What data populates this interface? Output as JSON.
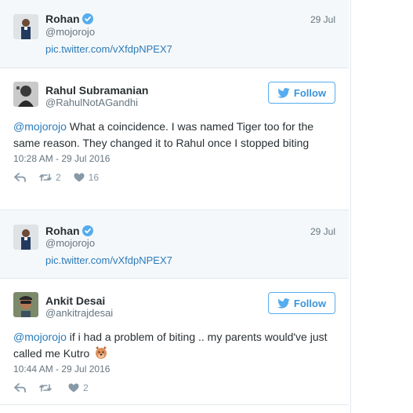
{
  "colors": {
    "accent": "#55acee",
    "link": "#2b7bb9",
    "muted": "#66757f",
    "quoted_bg": "#f5f8fa"
  },
  "thread": [
    {
      "quoted": {
        "name": "Rohan",
        "verified": true,
        "handle": "@mojorojo",
        "date": "29 Jul",
        "link": "pic.twitter.com/vXfdpNPEX7"
      }
    },
    {
      "reply": {
        "name": "Rahul Subramanian",
        "handle": "@RahulNotAGandhi",
        "follow_label": "Follow",
        "mention": "@mojorojo",
        "text": " What a coincidence. I was named Tiger too for the same reason. They changed it to Rahul once I stopped biting",
        "time": "10:28 AM - 29 Jul 2016",
        "retweets": "2",
        "likes": "16",
        "icons": [
          "reply-icon",
          "retweet-icon",
          "heart-icon",
          "twitter-bird-icon"
        ]
      }
    },
    {
      "quoted": {
        "name": "Rohan",
        "verified": true,
        "handle": "@mojorojo",
        "date": "29 Jul",
        "link": "pic.twitter.com/vXfdpNPEX7"
      }
    },
    {
      "reply": {
        "name": "Ankit Desai",
        "handle": "@ankitrajdesai",
        "follow_label": "Follow",
        "mention": "@mojorojo",
        "text": " if i had a problem of biting .. my parents would've just called me Kutro",
        "emoji": "dog-face-emoji",
        "time": "10:44 AM - 29 Jul 2016",
        "retweets": "",
        "likes": "2",
        "icons": [
          "reply-icon",
          "retweet-icon",
          "heart-icon",
          "twitter-bird-icon"
        ]
      }
    }
  ]
}
